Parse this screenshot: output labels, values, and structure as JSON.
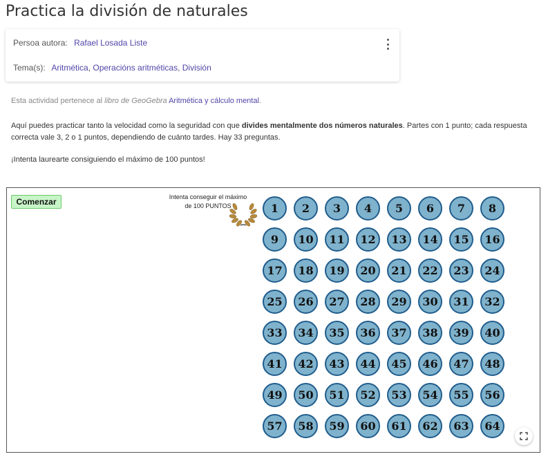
{
  "page": {
    "title": "Practica la división de naturales"
  },
  "info_card": {
    "author_label": "Persoa autora:",
    "author_name": "Rafael Losada Liste",
    "topics_label": "Tema(s):",
    "topics": [
      "Aritmética",
      "Operacións aritméticas",
      "División"
    ],
    "menu_icon": "more-vertical-icon"
  },
  "note": {
    "prefix": "Esta actividad pertenece al ",
    "book_italic": "libro de GeoGebra",
    "book_link": "Aritmética y cálculo mental",
    "suffix": "."
  },
  "description": {
    "part1": "Aquí puedes practicar tanto la velocidad como la seguridad con que ",
    "bold": "divides mentalmente dos números naturales",
    "part2": ".  Partes con 1 punto; cada respuesta correcta vale 3, 2 o 1 puntos, dependiendo de cuánto tardes. Hay 33 preguntas."
  },
  "challenge": "¡Intenta laurearte consiguiendo el máximo de 100 puntos!",
  "applet": {
    "start_label": "Comenzar",
    "goal_line1": "Intenta conseguir el máximo",
    "goal_line2": "de 100 PUNTOS",
    "laurel_icon": "laurel-wreath-icon",
    "fullscreen_icon": "fullscreen-icon",
    "circle_fill": "#7fb2cc",
    "circle_border": "#1f5c8c",
    "numbers": [
      1,
      2,
      3,
      4,
      5,
      6,
      7,
      8,
      9,
      10,
      11,
      12,
      13,
      14,
      15,
      16,
      17,
      18,
      19,
      20,
      21,
      22,
      23,
      24,
      25,
      26,
      27,
      28,
      29,
      30,
      31,
      32,
      33,
      34,
      35,
      36,
      37,
      38,
      39,
      40,
      41,
      42,
      43,
      44,
      45,
      46,
      47,
      48,
      49,
      50,
      51,
      52,
      53,
      54,
      55,
      56,
      57,
      58,
      59,
      60,
      61,
      62,
      63,
      64
    ]
  },
  "colors": {
    "link": "#5145a8",
    "start_button_bg": "#c8f5c8"
  }
}
